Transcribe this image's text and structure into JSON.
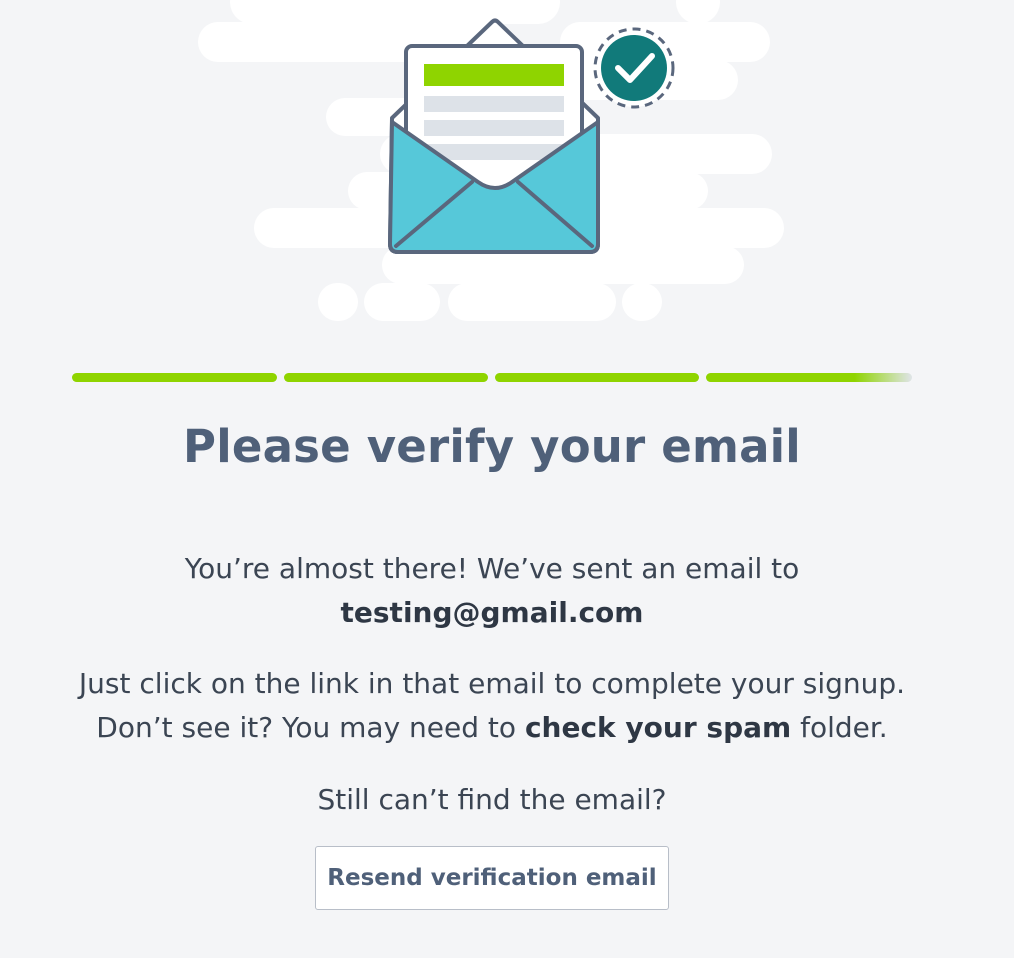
{
  "progress": {
    "steps_total": 4,
    "steps_completed": 4,
    "color": "#8fd400"
  },
  "title": "Please verify your email",
  "message": {
    "line1": "You’re almost there! We’ve sent an email to",
    "email": "testing@gmail.com",
    "instructions_line1": "Just click on the link in that email to complete your signup.",
    "instructions_line2_prefix": "Don’t see it? You may need to ",
    "instructions_line2_bold": "check your spam",
    "instructions_line2_suffix": " folder.",
    "still_cant_find": "Still can’t find the email?"
  },
  "resend_button": {
    "label": "Resend verification email"
  },
  "illustration": {
    "icons": [
      "open-envelope-icon",
      "letter-icon",
      "checkmark-badge-icon"
    ],
    "colors": {
      "envelope_fill": "#56c8d9",
      "outline": "#5a677d",
      "letter_accent": "#8fd400",
      "badge": "#117a7a"
    }
  }
}
